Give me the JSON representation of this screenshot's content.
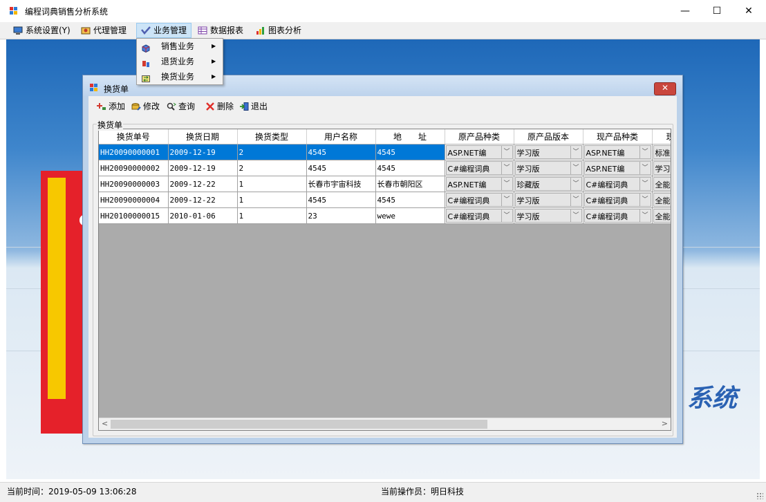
{
  "window": {
    "title": "编程词典销售分析系统",
    "min_label": "—",
    "max_label": "☐",
    "close_label": "✕"
  },
  "menubar": {
    "items": [
      {
        "label": "系统设置(Y)",
        "icon": "computer-icon"
      },
      {
        "label": "代理管理",
        "icon": "agent-icon"
      },
      {
        "label": "业务管理",
        "icon": "check-icon"
      },
      {
        "label": "数据报表",
        "icon": "table-icon"
      },
      {
        "label": "图表分析",
        "icon": "bar-chart-icon"
      }
    ]
  },
  "dropdown": {
    "items": [
      {
        "label": "销售业务",
        "icon": "cube-icon"
      },
      {
        "label": "退货业务",
        "icon": "return-icon"
      },
      {
        "label": "换货业务",
        "icon": "exchange-icon"
      }
    ]
  },
  "subwindow": {
    "title": "换货单",
    "close_label": "✕",
    "toolbar": {
      "add": "添加",
      "edit": "修改",
      "query": "查询",
      "delete": "删除",
      "exit": "退出"
    },
    "group_label": "换货单",
    "columns": [
      "换货单号",
      "换货日期",
      "换货类型",
      "用户名称",
      "地　　址",
      "原产品种类",
      "原产品版本",
      "现产品种类",
      "现"
    ],
    "rows": [
      [
        "HH20090000001",
        "2009-12-19",
        "2",
        "4545",
        "4545",
        "ASP.NET编",
        "学习版",
        "ASP.NET编",
        "标准"
      ],
      [
        "HH20090000002",
        "2009-12-19",
        "2",
        "4545",
        "4545",
        "C#编程词典",
        "学习版",
        "ASP.NET编",
        "学习"
      ],
      [
        "HH20090000003",
        "2009-12-22",
        "1",
        "长春市宇宙科技",
        "长春市朝阳区",
        "ASP.NET编",
        "珍藏版",
        "C#编程词典",
        "全能"
      ],
      [
        "HH20090000004",
        "2009-12-22",
        "1",
        "4545",
        "4545",
        "C#编程词典",
        "学习版",
        "C#编程词典",
        "全能"
      ],
      [
        "HH20100000015",
        "2010-01-06",
        "1",
        "23",
        "wewe",
        "C#编程词典",
        "学习版",
        "C#编程词典",
        "全能"
      ]
    ],
    "selected_row": 0
  },
  "background": {
    "banner_text": "系统",
    "book_text": "C#"
  },
  "statusbar": {
    "time_label": "当前时间：2019-05-09 13:06:28",
    "operator_label": "当前操作员：明日科技"
  }
}
